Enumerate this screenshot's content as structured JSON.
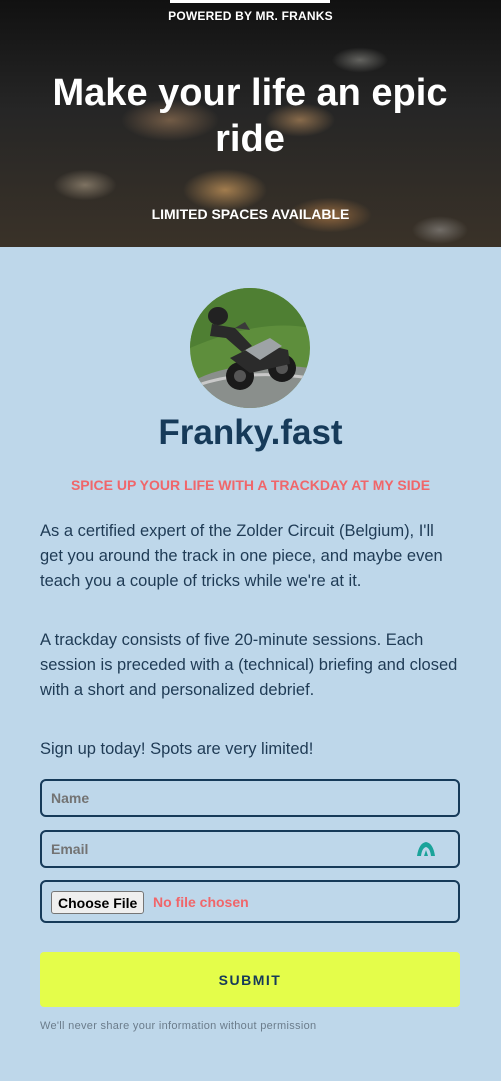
{
  "hero": {
    "powered_by": "POWERED BY MR. FRANKS",
    "headline": {
      "part1": "Make ",
      "part2": "your life",
      "part3": " an ",
      "part4": "epic ride"
    },
    "limited": "LIMITED SPACES AVAILABLE"
  },
  "profile": {
    "name": "Franky.fast",
    "tagline": "SPICE UP YOUR LIFE WITH A TRACKDAY AT MY SIDE"
  },
  "body": {
    "paragraph1": "As a certified expert of the Zolder Circuit (Belgium), I'll get you around the track in one piece, and maybe even teach you a couple of tricks while we're at it.",
    "paragraph2": "A trackday consists of five 20-minute sessions. Each session is preceded with a (technical) briefing and closed with a short and personalized debrief.",
    "paragraph3": "Sign up today! Spots are very limited!"
  },
  "form": {
    "name_placeholder": "Name",
    "email_placeholder": "Email",
    "file_button": "Choose File",
    "file_status": "No file chosen",
    "submit": "SUBMIT",
    "privacy_note": "We'll never share your information without permission"
  },
  "colors": {
    "background": "#bed7ea",
    "accent_red": "#f0666a",
    "submit_bg": "#e4fd4a",
    "navy": "#163a59"
  }
}
